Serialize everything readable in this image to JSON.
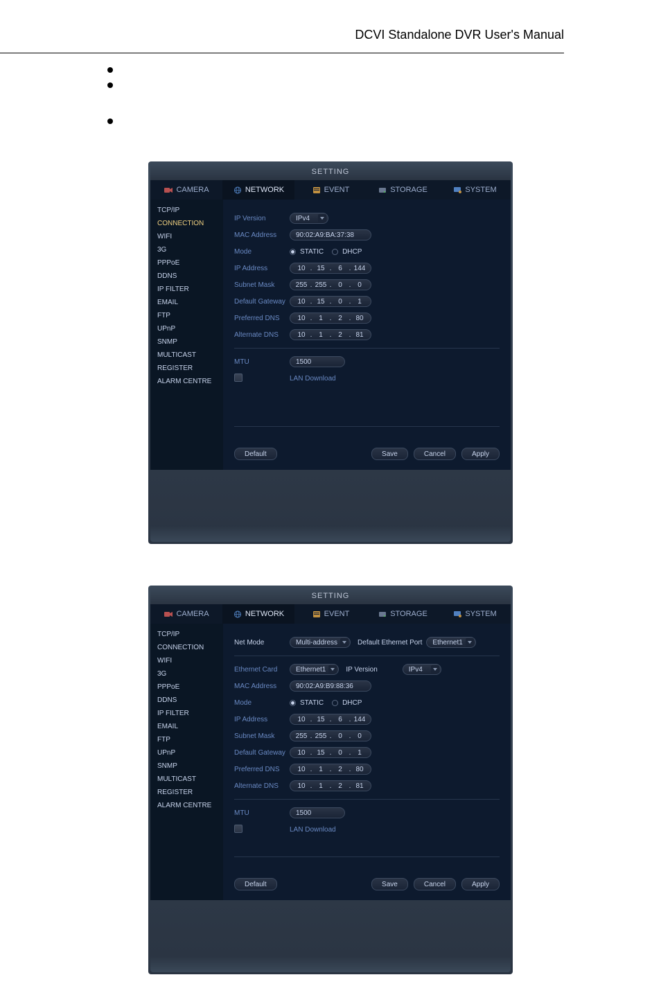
{
  "doc_title": "DCVI Standalone DVR User's Manual",
  "window_title": "SETTING",
  "tabs_top": [
    "CAMERA",
    "NETWORK",
    "EVENT",
    "STORAGE",
    "SYSTEM"
  ],
  "sidebar_items": [
    "TCP/IP",
    "CONNECTION",
    "WIFI",
    "3G",
    "PPPoE",
    "DDNS",
    "IP FILTER",
    "EMAIL",
    "FTP",
    "UPnP",
    "SNMP",
    "MULTICAST",
    "REGISTER",
    "ALARM CENTRE"
  ],
  "panel1": {
    "labels": {
      "ip_version": "IP Version",
      "mac_address": "MAC Address",
      "mode": "Mode",
      "ip_address": "IP Address",
      "subnet_mask": "Subnet Mask",
      "default_gateway": "Default Gateway",
      "preferred_dns": "Preferred DNS",
      "alternate_dns": "Alternate DNS",
      "mtu": "MTU",
      "lan_download": "LAN Download"
    },
    "values": {
      "ip_version": "IPv4",
      "mac_address": "90:02:A9:BA:37:38",
      "mode_static": "STATIC",
      "mode_dhcp": "DHCP",
      "ip_address": [
        "10",
        "15",
        "6",
        "144"
      ],
      "subnet_mask": [
        "255",
        "255",
        "0",
        "0"
      ],
      "default_gateway": [
        "10",
        "15",
        "0",
        "1"
      ],
      "preferred_dns": [
        "10",
        "1",
        "2",
        "80"
      ],
      "alternate_dns": [
        "10",
        "1",
        "2",
        "81"
      ],
      "mtu": "1500"
    }
  },
  "panel2": {
    "labels": {
      "net_mode": "Net Mode",
      "default_eth_port": "Default Ethernet Port",
      "ethernet_card": "Ethernet Card",
      "ip_version": "IP Version",
      "mac_address": "MAC Address",
      "mode": "Mode",
      "ip_address": "IP Address",
      "subnet_mask": "Subnet Mask",
      "default_gateway": "Default Gateway",
      "preferred_dns": "Preferred DNS",
      "alternate_dns": "Alternate DNS",
      "mtu": "MTU",
      "lan_download": "LAN Download"
    },
    "values": {
      "net_mode": "Multi-address",
      "default_eth_port": "Ethernet1",
      "ethernet_card": "Ethernet1",
      "ip_version": "IPv4",
      "mac_address": "90:02:A9:B9:88:36",
      "mode_static": "STATIC",
      "mode_dhcp": "DHCP",
      "ip_address": [
        "10",
        "15",
        "6",
        "144"
      ],
      "subnet_mask": [
        "255",
        "255",
        "0",
        "0"
      ],
      "default_gateway": [
        "10",
        "15",
        "0",
        "1"
      ],
      "preferred_dns": [
        "10",
        "1",
        "2",
        "80"
      ],
      "alternate_dns": [
        "10",
        "1",
        "2",
        "81"
      ],
      "mtu": "1500"
    }
  },
  "buttons": {
    "default": "Default",
    "save": "Save",
    "cancel": "Cancel",
    "apply": "Apply"
  }
}
